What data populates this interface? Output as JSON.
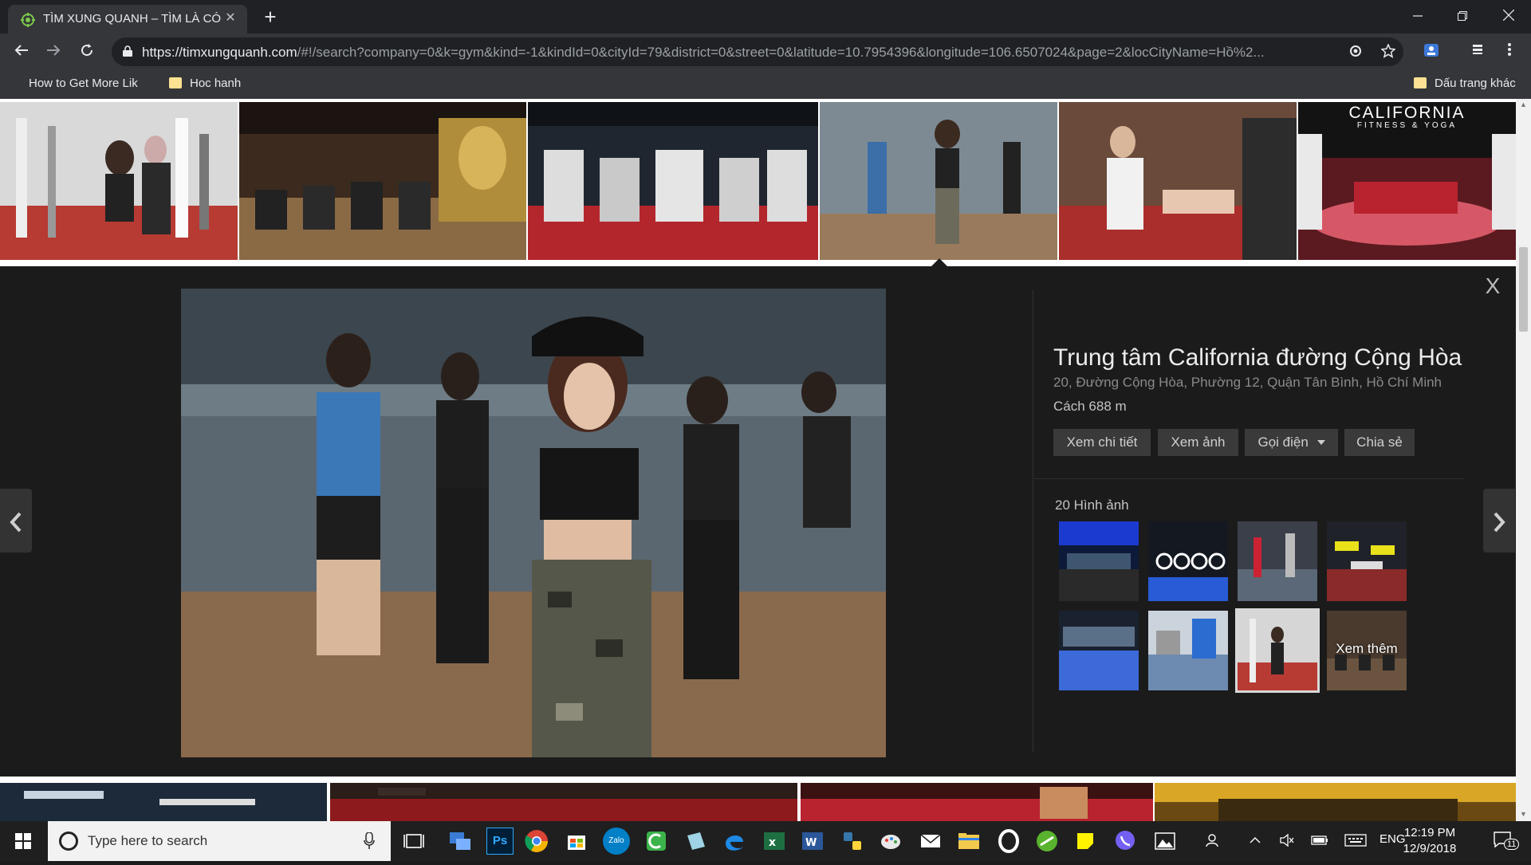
{
  "browser": {
    "tab_title": "TÌM XUNG QUANH – TÌM LÀ CÓ",
    "tab_close": "✕",
    "new_tab": "+",
    "url_host": "https://timxungquanh.com",
    "url_path": "/#!/search?company=0&k=gym&kind=-1&kindId=0&cityId=79&district=0&street=0&latitude=10.7954396&longitude=106.6507024&page=2&locCityName=Hồ%2...",
    "bookmarks": [
      "How to Get More Lik",
      "Hoc hanh"
    ],
    "other_bookmarks": "Dấu trang khác"
  },
  "viewer": {
    "close": "X",
    "prev": "‹",
    "next": "›",
    "place_name": "Trung tâm California đường Cộng Hòa",
    "address": "20, Đường Cộng Hòa, Phường 12, Quận Tân Bình, Hồ Chí Minh",
    "distance": "Cách 688 m",
    "actions": {
      "details": "Xem chi tiết",
      "photos": "Xem ảnh",
      "call": "Gọi điện",
      "share": "Chia sẻ"
    },
    "gallery_count": "20 Hình ảnh",
    "see_more": "Xem thêm",
    "top_thumb_banner": "CALIFORNIA",
    "top_thumb_sub": "FITNESS & YOGA"
  },
  "taskbar": {
    "search_placeholder": "Type here to search",
    "language": "ENG",
    "time": "12:19 PM",
    "date": "12/9/2018",
    "notifications": "11",
    "photoshop": "Ps",
    "zalo": "Zalo"
  },
  "colors": {
    "chrome_dark": "#202124",
    "chrome_toolbar": "#35363a",
    "viewer_bg": "#1b1b1b",
    "accent_red": "#c3272b"
  }
}
